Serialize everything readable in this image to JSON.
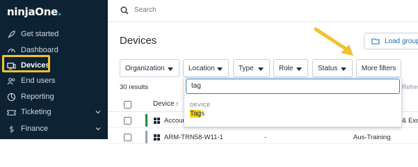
{
  "app": {
    "logo": {
      "text_main": "ninja",
      "text_brand": "One",
      "dot": "."
    }
  },
  "sidebar": {
    "items": [
      {
        "label": "Get started",
        "icon": "rocket-icon"
      },
      {
        "label": "Dashboard",
        "icon": "speedometer-icon"
      },
      {
        "label": "Devices",
        "icon": "devices-icon",
        "active": true
      },
      {
        "label": "End users",
        "icon": "users-icon"
      },
      {
        "label": "Reporting",
        "icon": "chart-icon"
      },
      {
        "label": "Ticketing",
        "icon": "ticket-icon",
        "expandable": true
      },
      {
        "label": "Finance",
        "icon": "dollar-icon",
        "expandable": true
      }
    ]
  },
  "topbar": {
    "search_placeholder": "Search"
  },
  "main": {
    "title": "Devices",
    "load_group_label": "Load group",
    "filters": [
      {
        "label": "Organization"
      },
      {
        "label": "Location"
      },
      {
        "label": "Type"
      },
      {
        "label": "Role"
      },
      {
        "label": "Status"
      }
    ],
    "more_filters_label": "More filters",
    "results_count": "30 results",
    "refresh_label": "Refresh",
    "table": {
      "header_device": "Device",
      "sort_arrow": "↑",
      "rows": [
        {
          "device": "Accoun",
          "col2": "",
          "col3": "& Exc"
        },
        {
          "device": "ARM-TRN58-W11-1",
          "col2": "-",
          "col3": "Aus-Training"
        }
      ]
    }
  },
  "dropdown": {
    "query": "tag",
    "section": "DEVICE",
    "option_match": "Tag",
    "option_rest": "s"
  },
  "colors": {
    "sidebar_bg": "#0d2232",
    "accent_blue": "#2e7fc4",
    "highlight": "#f5d520",
    "annotation": "#f2c230",
    "status_green": "#1e8a3e"
  }
}
